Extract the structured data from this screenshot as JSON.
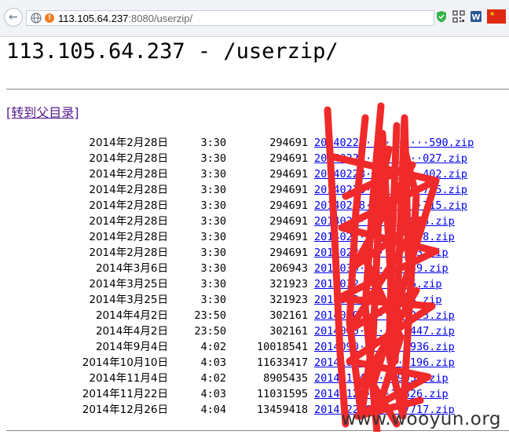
{
  "browser": {
    "url_host": "113.105.64.237",
    "url_rest": ":8080/userzip/",
    "icons": [
      "back-arrow-icon",
      "globe-icon",
      "warning-icon",
      "shield-icon",
      "qr-code-icon",
      "word-icon",
      "china-flag-icon"
    ]
  },
  "page": {
    "title": "113.105.64.237 - /userzip/",
    "parent_link": "[转到父目录]"
  },
  "files": [
    {
      "date": "2014年2月28日",
      "time": "3:30",
      "size": "294691",
      "name": "20140228··········590.zip"
    },
    {
      "date": "2014年2月28日",
      "time": "3:30",
      "size": "294691",
      "name": "20140228·········027.zip"
    },
    {
      "date": "2014年2月28日",
      "time": "3:30",
      "size": "294691",
      "name": "20140228·········402.zip"
    },
    {
      "date": "2014年2月28日",
      "time": "3:30",
      "size": "294691",
      "name": "20140228·········715.zip"
    },
    {
      "date": "2014年2月28日",
      "time": "3:30",
      "size": "294691",
      "name": "20140228·········715.zip"
    },
    {
      "date": "2014年2月28日",
      "time": "3:30",
      "size": "294691",
      "name": "2014022········808.zip"
    },
    {
      "date": "2014年2月28日",
      "time": "3:30",
      "size": "294691",
      "name": "2014022········808.zip"
    },
    {
      "date": "2014年2月28日",
      "time": "3:30",
      "size": "294691",
      "name": "2014022········93.zip"
    },
    {
      "date": "2014年3月6日",
      "time": "3:30",
      "size": "206943",
      "name": "2014030········49.zip"
    },
    {
      "date": "2014年3月25日",
      "time": "3:30",
      "size": "321923",
      "name": "2014032········6.zip"
    },
    {
      "date": "2014年3月25日",
      "time": "3:30",
      "size": "321923",
      "name": "2014032········4.zip"
    },
    {
      "date": "2014年4月2日",
      "time": "23:50",
      "size": "302161",
      "name": "2014040········293.zip"
    },
    {
      "date": "2014年4月2日",
      "time": "23:50",
      "size": "302161",
      "name": "2014040········447.zip"
    },
    {
      "date": "2014年9月4日",
      "time": "4:02",
      "size": "10018541",
      "name": "2014090········936.zip"
    },
    {
      "date": "2014年10月10日",
      "time": "4:03",
      "size": "11633417",
      "name": "2014101········196.zip"
    },
    {
      "date": "2014年11月4日",
      "time": "4:02",
      "size": "8905435",
      "name": "20141104·····9050.zip"
    },
    {
      "date": "2014年11月22日",
      "time": "4:03",
      "size": "11031595",
      "name": "20141122····26826.zip"
    },
    {
      "date": "2014年12月26日",
      "time": "4:04",
      "size": "13459418",
      "name": "20141226042··17717.zip"
    }
  ],
  "watermark": "www.wooyun.org",
  "colors": {
    "link": "#0000ee",
    "visited": "#551a8b",
    "redaction": "#f02a2a"
  }
}
